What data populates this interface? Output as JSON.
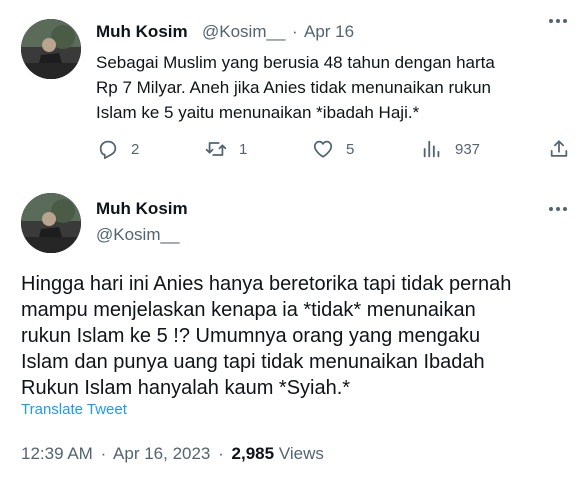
{
  "tweet1": {
    "name": "Muh Kosim",
    "handle": "@Kosim__",
    "separator": "·",
    "date": "Apr 16",
    "text_lines": [
      "Sebagai Muslim yang berusia 48 tahun dengan harta",
      "Rp 7 Milyar. Aneh jika Anies tidak menunaikan rukun",
      "Islam ke 5 yaitu menunaikan *ibadah Haji.*"
    ],
    "actions": {
      "reply_count": "2",
      "retweet_count": "1",
      "like_count": "5",
      "views_count": "937"
    },
    "icons": [
      "more-icon",
      "reply-icon",
      "retweet-icon",
      "like-icon",
      "views-icon",
      "share-icon"
    ]
  },
  "tweet2": {
    "name": "Muh Kosim",
    "handle": "@Kosim__",
    "text_lines": [
      "Hingga hari ini Anies hanya beretorika tapi tidak pernah",
      "mampu menjelaskan kenapa ia *tidak* menunaikan",
      "rukun Islam ke 5 !?  Umumnya orang yang mengaku",
      "Islam dan punya uang tapi tidak menunaikan Ibadah",
      "Rukun Islam hanyalah kaum *Syiah.*"
    ],
    "translate_label": "Translate Tweet",
    "time": "12:39 AM",
    "date": "Apr 16, 2023",
    "dot": "·",
    "views_count": "2,985",
    "views_label": "Views"
  },
  "colors": {
    "text": "#0f1419",
    "secondary": "#536471",
    "link": "#1d9bf0",
    "background": "#ffffff"
  }
}
